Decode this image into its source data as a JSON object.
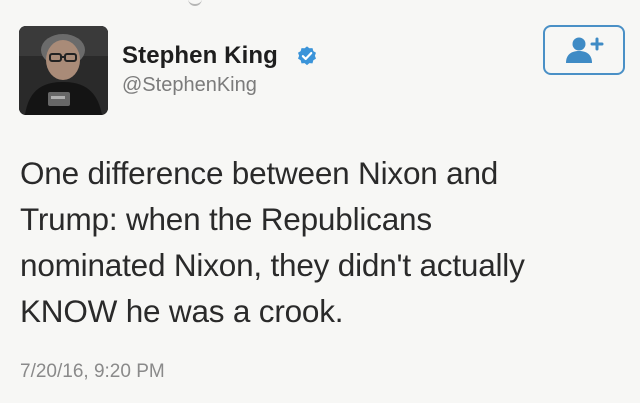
{
  "author": {
    "display_name": "Stephen King",
    "handle": "@StephenKing",
    "verified": true
  },
  "tweet": {
    "lines": [
      "One difference between Nixon and",
      "Trump: when the Republicans",
      "nominated Nixon, they didn't actually",
      "KNOW he was a crook."
    ],
    "timestamp": "7/20/16, 9:20 PM"
  },
  "icons": {
    "verified": "verified-badge-icon",
    "follow": "add-user-icon"
  },
  "colors": {
    "accent": "#4a90c6",
    "verified": "#3b94d9",
    "text": "#2a2a2a",
    "muted": "#7b7b7b"
  }
}
